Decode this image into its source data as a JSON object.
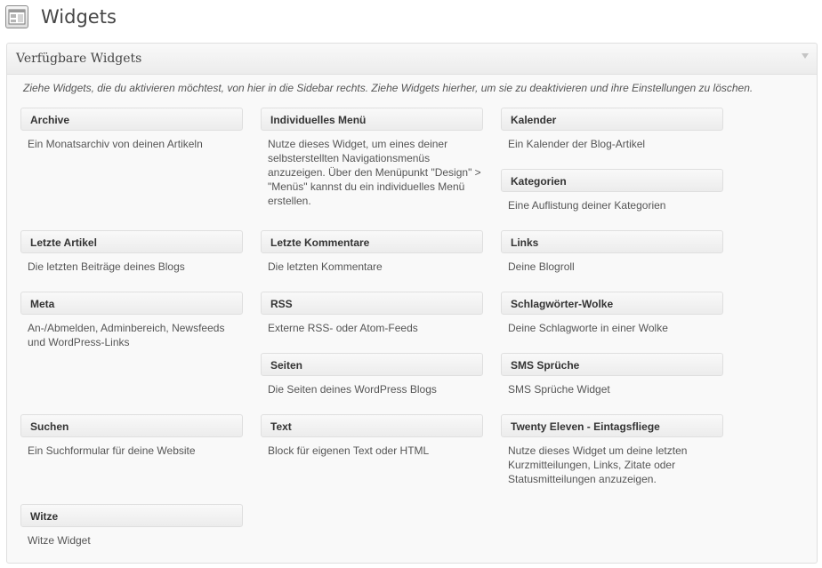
{
  "page": {
    "title": "Widgets",
    "icon": "widgets-screen-icon"
  },
  "available": {
    "title": "Verfügbare Widgets",
    "toggle_icon": "collapse-arrow-icon",
    "description": "Ziehe Widgets, die du aktivieren möchtest, von hier in die Sidebar rechts. Ziehe Widgets hierher, um sie zu deaktivieren und ihre Einstellungen zu löschen.",
    "widgets": [
      {
        "name": "Archive",
        "desc": "Ein Monatsarchiv von deinen Artikeln"
      },
      {
        "name": "Individuelles Menü",
        "desc": "Nutze dieses Widget, um eines deiner selbsterstellten Navigationsmenüs anzuzeigen. Über den Menüpunkt \"Design\" > \"Menüs\" kannst du ein individuelles Menü erstellen."
      },
      {
        "name": "Kalender",
        "desc": "Ein Kalender der Blog-Artikel"
      },
      {
        "name": "Kategorien",
        "desc": "Eine Auflistung deiner Kategorien"
      },
      {
        "name": "Letzte Artikel",
        "desc": "Die letzten Beiträge deines Blogs"
      },
      {
        "name": "Letzte Kommentare",
        "desc": "Die letzten Kommentare"
      },
      {
        "name": "Links",
        "desc": "Deine Blogroll"
      },
      {
        "name": "Meta",
        "desc": "An-/Abmelden, Adminbereich, Newsfeeds und WordPress-Links"
      },
      {
        "name": "RSS",
        "desc": "Externe RSS- oder Atom-Feeds"
      },
      {
        "name": "Schlagwörter-Wolke",
        "desc": "Deine Schlagworte in einer Wolke"
      },
      {
        "name": "Seiten",
        "desc": "Die Seiten deines WordPress Blogs"
      },
      {
        "name": "SMS Sprüche",
        "desc": "SMS Sprüche Widget"
      },
      {
        "name": "Suchen",
        "desc": "Ein Suchformular für deine Website"
      },
      {
        "name": "Text",
        "desc": "Block für eigenen Text oder HTML"
      },
      {
        "name": "Twenty Eleven - Eintagsfliege",
        "desc": "Nutze dieses Widget um deine letzten Kurzmitteilungen, Links, Zitate oder Statusmitteilungen anzuzeigen."
      },
      {
        "name": "Witze",
        "desc": "Witze Widget"
      }
    ]
  }
}
